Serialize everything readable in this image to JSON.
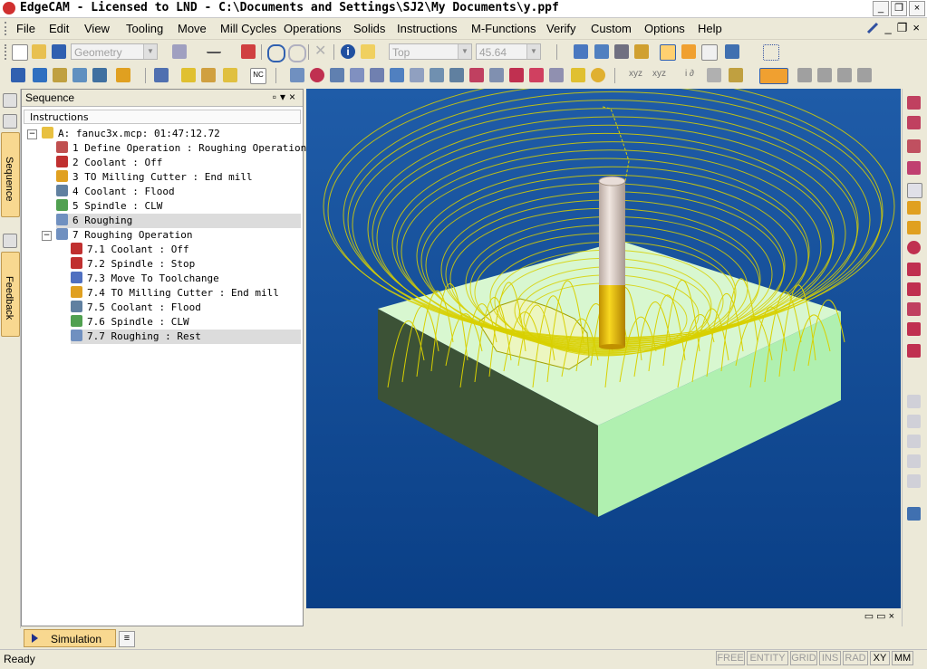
{
  "window": {
    "title": "EdgeCAM - Licensed to LND - C:\\Documents and Settings\\SJ2\\My Documents\\y.ppf"
  },
  "menu": [
    "File",
    "Edit",
    "View",
    "Tooling",
    "Move",
    "Mill Cycles",
    "Operations",
    "Solids",
    "Instructions",
    "M-Functions",
    "Verify",
    "Custom",
    "Options",
    "Help"
  ],
  "toolbar": {
    "geometry_combo": "Geometry",
    "view_combo": "Top",
    "depth_combo": "45.64",
    "coord_icons": [
      "xyz",
      "xyz",
      "i ∂"
    ]
  },
  "left_tabs": [
    "Sequence",
    "Feedback"
  ],
  "sequence": {
    "panel_title": "Sequence",
    "column_header": "Instructions",
    "rows": [
      {
        "label": "A:  fanuc3x.mcp: 01:47:12.72",
        "level": 0,
        "expander": "−",
        "icon": "nc-file-icon",
        "color": "#e8c040"
      },
      {
        "label": "1 Define Operation : Roughing Operation",
        "level": 1,
        "icon": "define-operation-icon",
        "color": "#c05050"
      },
      {
        "label": "2 Coolant : Off",
        "level": 1,
        "icon": "coolant-icon",
        "color": "#c03030"
      },
      {
        "label": "3 TO Milling Cutter : End mill",
        "level": 1,
        "icon": "milling-cutter-icon",
        "color": "#e0a020"
      },
      {
        "label": "4 Coolant : Flood",
        "level": 1,
        "icon": "coolant-icon",
        "color": "#6080a0"
      },
      {
        "label": "5 Spindle : CLW",
        "level": 1,
        "icon": "spindle-icon",
        "color": "#50a050"
      },
      {
        "label": "6 Roughing",
        "level": 1,
        "icon": "roughing-icon",
        "color": "#7090c0",
        "selected": true
      },
      {
        "label": "7 Roughing Operation",
        "level": 1,
        "expander": "−",
        "icon": "operation-icon",
        "color": "#7090c0"
      },
      {
        "label": "7.1 Coolant : Off",
        "level": 2,
        "icon": "coolant-icon",
        "color": "#c03030"
      },
      {
        "label": "7.2 Spindle :     Stop",
        "level": 2,
        "icon": "spindle-icon",
        "color": "#c03030"
      },
      {
        "label": "7.3 Move To Toolchange",
        "level": 2,
        "icon": "toolchange-icon",
        "color": "#5070c0"
      },
      {
        "label": "7.4 TO Milling Cutter : End mill",
        "level": 2,
        "icon": "milling-cutter-icon",
        "color": "#e0a020"
      },
      {
        "label": "7.5 Coolant : Flood",
        "level": 2,
        "icon": "coolant-icon",
        "color": "#6080a0"
      },
      {
        "label": "7.6 Spindle : CLW",
        "level": 2,
        "icon": "spindle-icon",
        "color": "#50a050"
      },
      {
        "label": "7.7 Roughing : Rest",
        "level": 2,
        "icon": "roughing-icon",
        "color": "#7090c0",
        "selected": true
      }
    ]
  },
  "viewport": {
    "background_top": "#1f5ca8",
    "background_bottom": "#0a3f86",
    "stock_top": "#d8f7d0",
    "stock_front": "#b0f0b0",
    "stock_side": "#3c5236",
    "toolpath_color": "#d8d000",
    "tool_shank": "#d8c8c0",
    "tool_flute": "#e8c000"
  },
  "bottom": {
    "simulation_tab": "Simulation"
  },
  "status": {
    "ready": "Ready",
    "indicators": [
      {
        "label": "FREE",
        "active": false
      },
      {
        "label": "ENTITY",
        "active": false
      },
      {
        "label": "GRID",
        "active": false
      },
      {
        "label": "INS",
        "active": false
      },
      {
        "label": "RAD",
        "active": false
      },
      {
        "label": "XY",
        "active": true
      },
      {
        "label": "MM",
        "active": true
      }
    ]
  }
}
